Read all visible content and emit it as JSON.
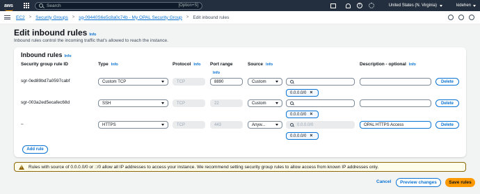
{
  "topbar": {
    "logo": "aws",
    "search_placeholder": "Search",
    "search_shortcut": "[Option+S]",
    "region": "United States (N. Virginia)",
    "user": "kidehen",
    "icons": [
      "services-grid-icon",
      "search-icon",
      "terminal-icon",
      "bell-icon",
      "help-icon",
      "settings-icon"
    ]
  },
  "breadcrumb": {
    "items": [
      "EC2",
      "Security Groups",
      "sg-09440S6e5c8a0c74b - My OPAL Security Group",
      "Edit inbound rules"
    ]
  },
  "page": {
    "title": "Edit inbound rules",
    "title_info": "Info",
    "description": "Inbound rules control the incoming traffic that's allowed to reach the instance."
  },
  "panel": {
    "title": "Inbound rules",
    "title_info": "Info",
    "columns": {
      "rule_id": "Security group rule ID",
      "type": "Type",
      "type_info": "Info",
      "protocol": "Protocol",
      "protocol_info": "Info",
      "port_range": "Port range",
      "port_range_info": "Info",
      "source": "Source",
      "source_info": "Info",
      "description": "Description - optional",
      "description_info": "Info"
    },
    "rows": [
      {
        "rule_id": "sgr-0ed89bd7a0597cabf",
        "type": "Custom TCP",
        "protocol": "TCP",
        "port_range": "8890",
        "source_type": "Custom",
        "source_search": "",
        "cidr": "0.0.0.0/0",
        "description": "",
        "delete_label": "Delete"
      },
      {
        "rule_id": "sgr-003a2ed5ecafec68d",
        "type": "SSH",
        "protocol": "TCP",
        "port_range": "22",
        "source_type": "Custom",
        "source_search": "",
        "cidr": "0.0.0.0/0",
        "description": "",
        "delete_label": "Delete"
      },
      {
        "rule_id": "–",
        "type": "HTTPS",
        "protocol": "TCP",
        "port_range": "443",
        "source_type": "Anyw...",
        "source_search": "0.0.0.0/0",
        "cidr": "0.0.0.0/0",
        "description": "OPAL HTTPS Access",
        "delete_label": "Delete"
      }
    ],
    "add_rule_label": "Add rule"
  },
  "warning": {
    "text": "Rules with source of 0.0.0.0/0 or ::/0 allow all IP addresses to access your instance. We recommend setting security group rules to allow access from known IP addresses only."
  },
  "footer": {
    "cancel_label": "Cancel",
    "preview_label": "Preview changes",
    "save_label": "Save rules"
  },
  "colors": {
    "topbar_bg": "#232f3e",
    "link_blue": "#0972d3",
    "primary_orange": "#ff9900",
    "warning_border": "#8d6605"
  }
}
